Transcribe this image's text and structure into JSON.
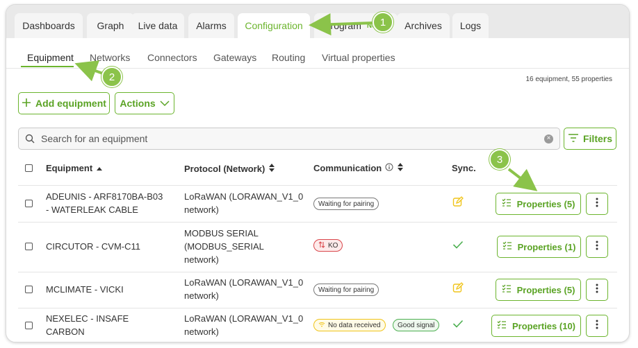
{
  "top_tabs": [
    {
      "label": "Dashboards"
    },
    {
      "label": "Graph"
    },
    {
      "label": "Live data"
    },
    {
      "label": "Alarms"
    },
    {
      "label": "Configuration"
    },
    {
      "label": "rogram",
      "badge": "New"
    },
    {
      "label": "Archives"
    },
    {
      "label": "Logs"
    }
  ],
  "sub_tabs": [
    {
      "label": "Equipment"
    },
    {
      "label": "Networks"
    },
    {
      "label": "Connectors"
    },
    {
      "label": "Gateways"
    },
    {
      "label": "Routing"
    },
    {
      "label": "Virtual properties"
    }
  ],
  "counts": "16 equipment, 55 properties",
  "toolbar": {
    "add_label": "Add equipment",
    "actions_label": "Actions",
    "filters_label": "Filters"
  },
  "search": {
    "placeholder": "Search for an equipment",
    "value": ""
  },
  "table": {
    "headers": {
      "equipment": "Equipment",
      "protocol": "Protocol (Network)",
      "communication": "Communication",
      "sync": "Sync."
    },
    "rows": [
      {
        "equipment_lines": [
          "ADEUNIS - ARF8170BA-B03",
          "- WATERLEAK CABLE"
        ],
        "protocol_lines": [
          "LoRaWAN (LORAWAN_V1_0",
          "network)"
        ],
        "status_pills": [
          {
            "label": "Waiting for pairing",
            "kind": "waiting"
          }
        ],
        "sync": "pending",
        "properties_label": "Properties (5)"
      },
      {
        "equipment_lines": [
          "CIRCUTOR - CVM-C11"
        ],
        "protocol_lines": [
          "MODBUS SERIAL",
          "(MODBUS_SERIAL",
          "network)"
        ],
        "status_pills": [
          {
            "label": "KO",
            "kind": "ko"
          }
        ],
        "sync": "ok",
        "properties_label": "Properties (1)"
      },
      {
        "equipment_lines": [
          "MCLIMATE - VICKI"
        ],
        "protocol_lines": [
          "LoRaWAN (LORAWAN_V1_0",
          "network)"
        ],
        "status_pills": [
          {
            "label": "Waiting for pairing",
            "kind": "waiting"
          }
        ],
        "sync": "pending",
        "properties_label": "Properties (5)"
      },
      {
        "equipment_lines": [
          "NEXELEC - INSAFE",
          "CARBON"
        ],
        "protocol_lines": [
          "LoRaWAN (LORAWAN_V1_0",
          "network)"
        ],
        "status_pills": [
          {
            "label": "No data received",
            "kind": "no-data"
          },
          {
            "label": "Good signal",
            "kind": "good"
          }
        ],
        "sync": "ok",
        "properties_label": "Properties (10)"
      }
    ]
  },
  "callouts": [
    "1",
    "2",
    "3"
  ],
  "colors": {
    "accent": "#6bb42d",
    "callout": "#8bc34a",
    "ko": "#d9464b",
    "warning": "#f0c419",
    "good": "#4caf50"
  }
}
